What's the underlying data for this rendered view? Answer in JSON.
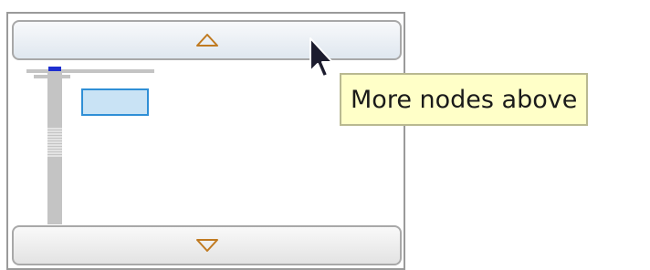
{
  "tooltip": {
    "text": "More nodes above"
  },
  "icons": {
    "scroll_up": "triangle-up-outline-icon",
    "scroll_down": "triangle-down-outline-icon",
    "cursor": "mouse-pointer-icon"
  },
  "colors": {
    "arrow": "#c07a20",
    "selection_fill": "#c9e3f5",
    "selection_border": "#2f8fd6",
    "tooltip_bg": "#ffffc8",
    "tree_lines": "#c4c4c4",
    "marker": "#1e2fd0"
  }
}
